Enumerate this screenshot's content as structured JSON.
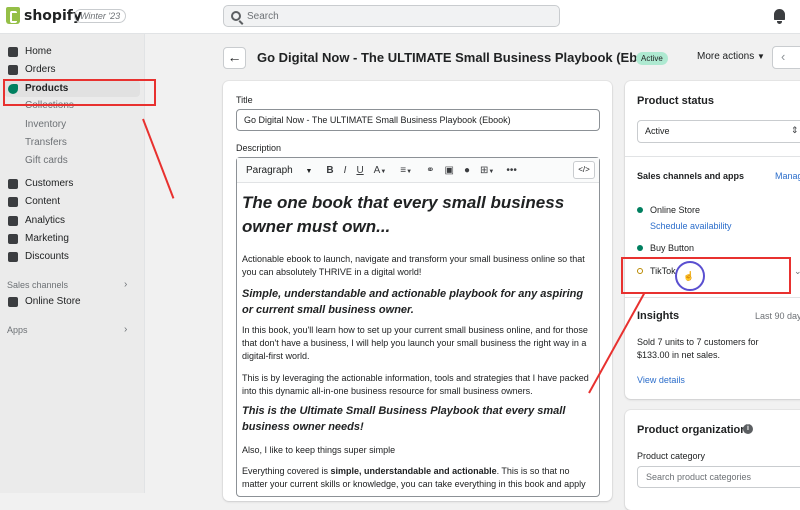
{
  "topbar": {
    "logo_text": "shopify",
    "edition": "Winter '23",
    "search_placeholder": "Search"
  },
  "sidebar": {
    "items": [
      {
        "label": "Home"
      },
      {
        "label": "Orders"
      },
      {
        "label": "Products"
      },
      {
        "label": "Collections"
      },
      {
        "label": "Inventory"
      },
      {
        "label": "Transfers"
      },
      {
        "label": "Gift cards"
      },
      {
        "label": "Customers"
      },
      {
        "label": "Content"
      },
      {
        "label": "Analytics"
      },
      {
        "label": "Marketing"
      },
      {
        "label": "Discounts"
      }
    ],
    "sales_channels_label": "Sales channels",
    "online_store": "Online Store",
    "apps_label": "Apps"
  },
  "header": {
    "title": "Go Digital Now - The ULTIMATE Small Business Playbook (Ebook)",
    "badge": "Active",
    "more_actions": "More actions"
  },
  "product": {
    "title_label": "Title",
    "title_value": "Go Digital Now - The ULTIMATE Small Business Playbook (Ebook)",
    "description_label": "Description",
    "toolbar_paragraph": "Paragraph",
    "description": {
      "h1": "The one book that every small business owner must own...",
      "p1": "Actionable ebook to launch, navigate and transform your small business online so that you can absolutely THRIVE in a digital world!",
      "h2": "Simple, understandable and actionable playbook for any aspiring or current small business owner.",
      "p2": "In this book, you'll learn how to set up your current small business online, and for those that don't have a business, I will help you launch your small business the right way in a digital-first world.",
      "p3": "This is by leveraging the actionable information, tools and strategies that I have packed into this dynamic all-in-one business resource for small business owners.",
      "h3": "This is the Ultimate Small Business Playbook that every small business owner needs!",
      "p4": "Also, I like to keep things super simple",
      "p5_a": "Everything covered is ",
      "p5_b": "simple, understandable and actionable",
      "p5_c": ". This is so that no matter your current skills or knowledge, you can take everything in this book and apply"
    }
  },
  "status": {
    "title": "Product status",
    "selected": "Active",
    "channels_title": "Sales channels and apps",
    "manage": "Manag",
    "online_store": "Online Store",
    "schedule": "Schedule availability",
    "buy_button": "Buy Button",
    "tiktok": "TikTok",
    "colors": {
      "published": "#007f5f",
      "pending": "#b98900"
    }
  },
  "insights": {
    "title": "Insights",
    "range": "Last 90 day",
    "summary": "Sold 7 units to 7 customers for $133.00 in net sales.",
    "view_details": "View details"
  },
  "organization": {
    "title": "Product organization",
    "category_label": "Product category",
    "category_placeholder": "Search product categories"
  }
}
